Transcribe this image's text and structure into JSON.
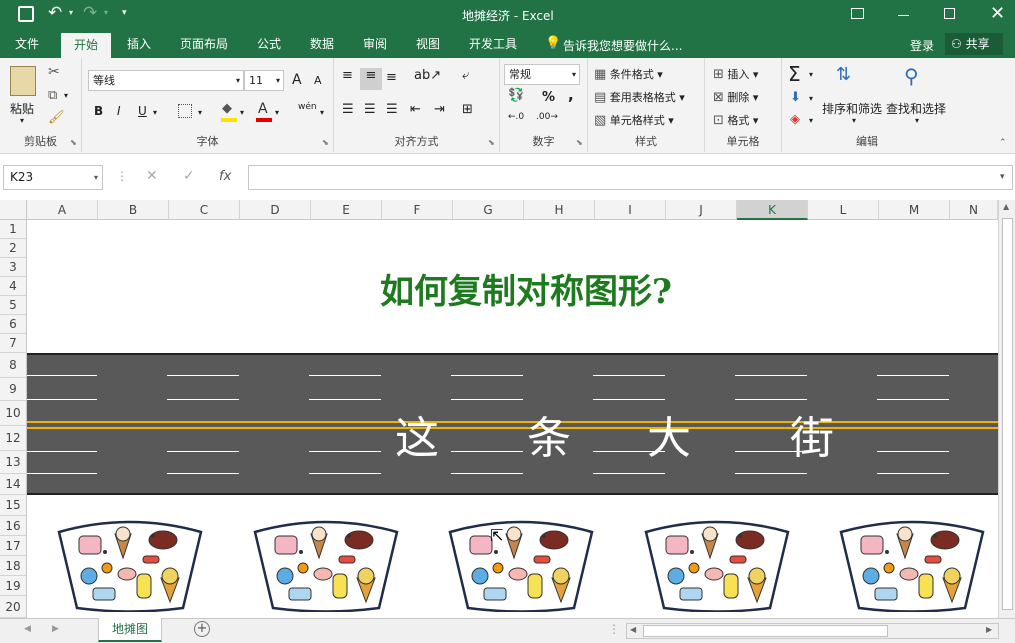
{
  "title_bar": {
    "doc_title": "地摊经济 - Excel"
  },
  "tabs": [
    {
      "label": "文件",
      "active": false
    },
    {
      "label": "开始",
      "active": true
    },
    {
      "label": "插入",
      "active": false
    },
    {
      "label": "页面布局",
      "active": false
    },
    {
      "label": "公式",
      "active": false
    },
    {
      "label": "数据",
      "active": false
    },
    {
      "label": "审阅",
      "active": false
    },
    {
      "label": "视图",
      "active": false
    },
    {
      "label": "开发工具",
      "active": false
    }
  ],
  "tell_me": "告诉我您想要做什么...",
  "login": "登录",
  "share": "共享",
  "ribbon": {
    "clipboard": {
      "label": "剪贴板",
      "paste": "粘贴"
    },
    "font": {
      "label": "字体",
      "font_name": "等线",
      "font_size": "11",
      "bold": "B",
      "italic": "I",
      "underline": "U",
      "grow": "A",
      "shrink": "A",
      "wen": "wén"
    },
    "align": {
      "label": "对齐方式"
    },
    "number": {
      "label": "数字",
      "format": "常规",
      "percent": "%",
      "comma": ","
    },
    "styles": {
      "label": "样式",
      "cond": "条件格式",
      "table": "套用表格格式",
      "cell": "单元格样式"
    },
    "cells": {
      "label": "单元格",
      "insert": "插入",
      "delete": "删除",
      "format": "格式"
    },
    "editing": {
      "label": "编辑",
      "sort": "排序和筛选",
      "find": "查找和选择"
    }
  },
  "formula_bar": {
    "name_box": "K23",
    "fx": "fx",
    "value": ""
  },
  "columns": [
    "A",
    "B",
    "C",
    "D",
    "E",
    "F",
    "G",
    "H",
    "I",
    "J",
    "K",
    "L",
    "M",
    "N"
  ],
  "rows": [
    "1",
    "2",
    "3",
    "4",
    "5",
    "6",
    "7",
    "8",
    "9",
    "10",
    "12",
    "13",
    "14",
    "15",
    "16",
    "17",
    "18",
    "19",
    "20"
  ],
  "sheet": {
    "heading": "如何复制对称图形?",
    "road_chars": [
      "这",
      "条",
      "大",
      "街"
    ]
  },
  "sheet_tabs": [
    {
      "label": "地摊图",
      "active": true
    }
  ],
  "colors": {
    "excel_green": "#217346",
    "heading_green": "#1e7a1e",
    "road": "#595959",
    "road_yellow": "#f0b400"
  }
}
